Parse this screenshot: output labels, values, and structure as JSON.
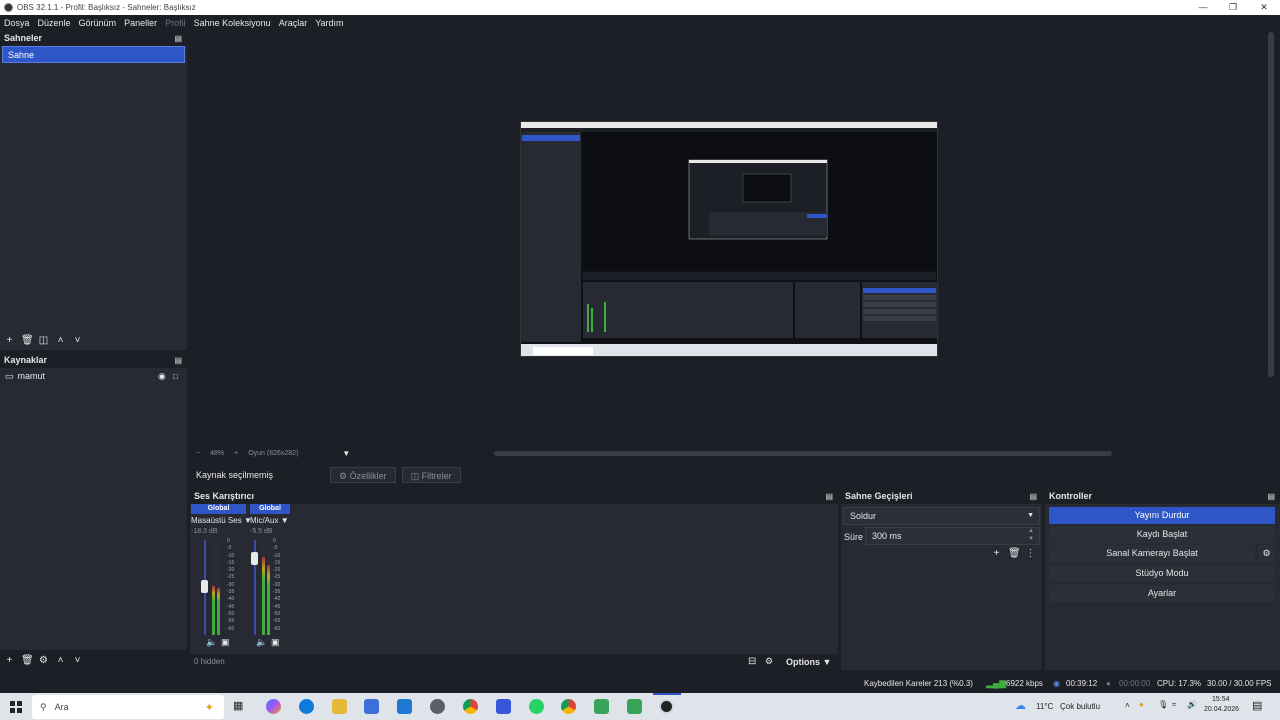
{
  "window": {
    "title": "OBS 32.1.1 - Profil: Başlıksız - Sahneler: Başlıksız"
  },
  "menu": [
    "Dosya",
    "Düzenle",
    "Görünüm",
    "Paneller",
    "Profil",
    "Sahne Koleksiyonu",
    "Araçlar",
    "Yardım"
  ],
  "scenes": {
    "title": "Sahneler",
    "items": [
      "Sahne"
    ]
  },
  "sources": {
    "title": "Kaynaklar",
    "items": [
      "mamut"
    ]
  },
  "preview": {
    "zoom": "48%",
    "fit": "Oyun (826x282)"
  },
  "properties_bar": {
    "no_source": "Kaynak seçilmemiş",
    "properties": "Özellikler",
    "filters": "Filtreler"
  },
  "mixer": {
    "title": "Ses Karıştırıcı",
    "channels": [
      {
        "head": "Global",
        "name": "Masaüstü Ses",
        "db": "-18.3 dB",
        "level": 0.52
      },
      {
        "head": "Global",
        "name": "Mic/Aux",
        "db": "-5.5 dB",
        "level": 0.82
      }
    ],
    "scale": [
      "0",
      "-5",
      "-10",
      "-15",
      "-20",
      "-25",
      "-30",
      "-35",
      "-40",
      "-45",
      "-50",
      "-55",
      "-60"
    ],
    "hidden": "0 hidden",
    "options": "Options"
  },
  "transitions": {
    "title": "Sahne Geçişleri",
    "selected": "Soldur",
    "duration_label": "Süre",
    "duration": "300 ms"
  },
  "controls": {
    "title": "Kontroller",
    "buttons": [
      "Yayını Durdur",
      "Kaydı Başlat",
      "Sanal Kamerayı Başlat",
      "Stüdyo Modu",
      "Ayarlar"
    ]
  },
  "status": {
    "dropped": "Kaybedilen Kareler 213 (%0.3)",
    "bitrate": "6922 kbps",
    "stream_time": "00:39:12",
    "rec_time": "00:00:00",
    "cpu": "CPU: 17.3%",
    "fps": "30.00 / 30.00 FPS"
  },
  "taskbar": {
    "search_placeholder": "Ara",
    "weather": "11°C",
    "weather_desc": "Çok bulutlu",
    "time": "15:54",
    "date": "20.04.2026"
  },
  "colors": {
    "accent": "#2f56c6",
    "bg": "#1d1f26",
    "panel": "#272a33",
    "meter_green": "#3fae3a",
    "meter_yellow": "#b6a72a"
  }
}
